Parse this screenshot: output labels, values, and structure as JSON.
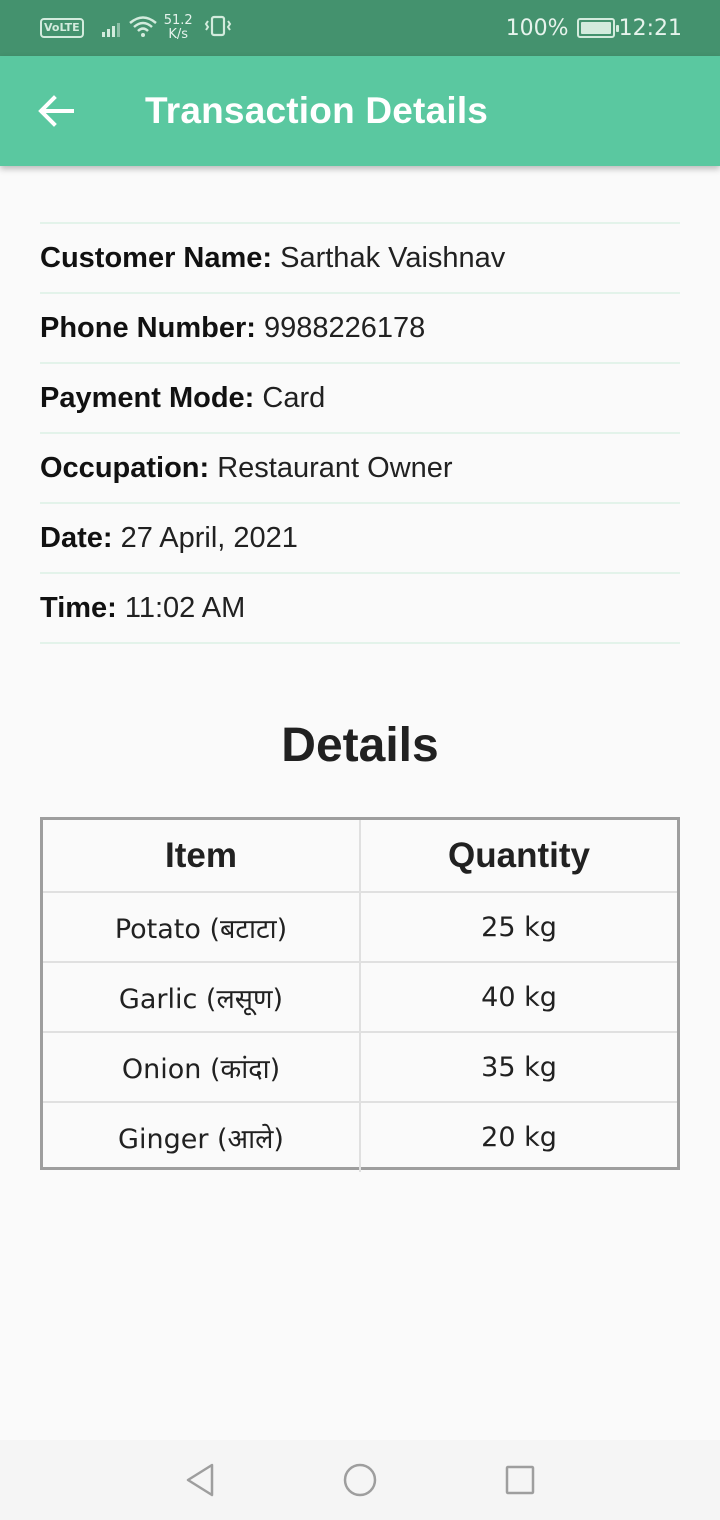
{
  "status_bar": {
    "network_badge": "VoLTE",
    "speed_value": "51.2",
    "speed_unit": "K/s",
    "battery": "100%",
    "time": "12:21"
  },
  "app_bar": {
    "title": "Transaction Details",
    "back_icon": "arrow-left-icon"
  },
  "info": {
    "customer_name": {
      "label": "Customer Name:",
      "value": "Sarthak Vaishnav"
    },
    "phone_number": {
      "label": "Phone Number:",
      "value": "9988226178"
    },
    "payment_mode": {
      "label": "Payment Mode:",
      "value": "Card"
    },
    "occupation": {
      "label": "Occupation:",
      "value": "Restaurant Owner"
    },
    "date": {
      "label": "Date:",
      "value": "27 April, 2021"
    },
    "time": {
      "label": "Time:",
      "value": "11:02 AM"
    }
  },
  "details": {
    "heading": "Details",
    "columns": [
      "Item",
      "Quantity"
    ],
    "rows": [
      {
        "item": "Potato (बटाटा)",
        "quantity": "25 kg"
      },
      {
        "item": "Garlic (लसूण)",
        "quantity": "40 kg"
      },
      {
        "item": "Onion (कांदा)",
        "quantity": "35 kg"
      },
      {
        "item": "Ginger (आले)",
        "quantity": "20 kg"
      }
    ]
  },
  "nav_bar": {
    "back": "triangle-back-icon",
    "home": "circle-home-icon",
    "recents": "square-recents-icon"
  },
  "colors": {
    "status_bar": "#44926e",
    "app_bar": "#5ac8a0",
    "divider": "#e3f3ea",
    "table_border": "#9e9e9e"
  }
}
